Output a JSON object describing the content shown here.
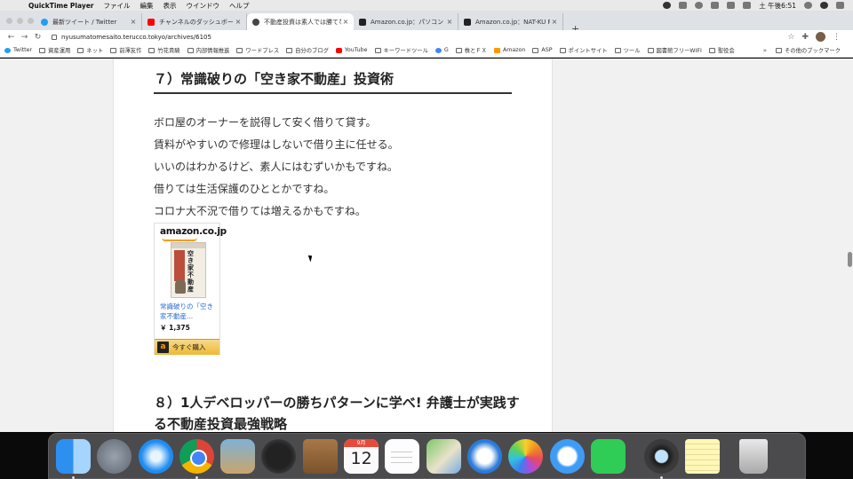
{
  "menubar": {
    "apple": "",
    "app_name": "QuickTime Player",
    "menus": [
      "ファイル",
      "編集",
      "表示",
      "ウインドウ",
      "ヘルプ"
    ],
    "clock": "土 午後6:51"
  },
  "browser": {
    "tabs": [
      {
        "title": "最新ツイート / Twitter",
        "favicon": "twitter-icon",
        "color": "#1da1f2"
      },
      {
        "title": "チャンネルのダッシュボード - YouTube",
        "favicon": "youtube-icon",
        "color": "#ff0000"
      },
      {
        "title": "不動産投資は素人では勝てない",
        "favicon": "wordpress-icon",
        "color": "#464646",
        "active": true
      },
      {
        "title": "Amazon.co.jp：パソコン",
        "favicon": "amazon-icon",
        "color": "#222222"
      },
      {
        "title": "Amazon.co.jp：NAT-KU PC スタンド",
        "favicon": "amazon-icon",
        "color": "#222222"
      }
    ],
    "new_tab": "+",
    "url": "nyusumatomesaito.terucco.tokyo/archives/6105",
    "bookmarks": [
      {
        "label": "Twitter",
        "icon": "twitter-icon"
      },
      {
        "label": "資産運用",
        "icon": "folder-icon"
      },
      {
        "label": "ネット",
        "icon": "folder-icon"
      },
      {
        "label": "前澤友作",
        "icon": "folder-icon"
      },
      {
        "label": "竹花貴騎",
        "icon": "folder-icon"
      },
      {
        "label": "内部情報推進",
        "icon": "folder-icon"
      },
      {
        "label": "ワードプレス",
        "icon": "folder-icon"
      },
      {
        "label": "自分のブログ",
        "icon": "folder-icon"
      },
      {
        "label": "YouTube",
        "icon": "youtube-icon"
      },
      {
        "label": "キーワードツール",
        "icon": "folder-icon"
      },
      {
        "label": "G",
        "icon": "google-icon"
      },
      {
        "label": "株とＦＸ",
        "icon": "folder-icon"
      },
      {
        "label": "Amazon",
        "icon": "amazon-icon"
      },
      {
        "label": "ASP",
        "icon": "folder-icon"
      },
      {
        "label": "ポイントサイト",
        "icon": "folder-icon"
      },
      {
        "label": "ツール",
        "icon": "folder-icon"
      },
      {
        "label": "図書館フリーWIFI",
        "icon": "folder-icon"
      },
      {
        "label": "聖役会",
        "icon": "folder-icon"
      }
    ],
    "other_bookmarks": "その他のブックマーク",
    "overflow": "»"
  },
  "article": {
    "heading7": "７）常識破りの「空き家不動産」投資術",
    "paragraphs": [
      "ボロ屋のオーナーを説得して安く借りて貸す。",
      "賃料がやすいので修理はしないで借り主に任せる。",
      "いいのはわかるけど、素人にはむずいかもですね。",
      "借りては生活保護のひととかですね。",
      "コロナ大不況で借りては増えるかもですね。"
    ],
    "product": {
      "logo": "amazon.co.jp",
      "cover_text": "空き家不動産",
      "title": "常識破りの「空き家不動産...",
      "price": "￥ 1,375",
      "buy_label": "今すぐ購入",
      "buy_icon": "a"
    },
    "heading8": "８）1人デベロッパーの勝ちパターンに学べ! 弁護士が実践する不動産投資最強戦略"
  },
  "dock": {
    "calendar_month": "9月",
    "calendar_day": "12",
    "apps": [
      "finder",
      "launchpad",
      "safari",
      "chrome",
      "mail-stamp",
      "dashboard",
      "contacts",
      "calendar",
      "reminders",
      "maps",
      "mail",
      "photos",
      "messages",
      "facetime",
      "quicktime",
      "notes",
      "trash"
    ]
  }
}
